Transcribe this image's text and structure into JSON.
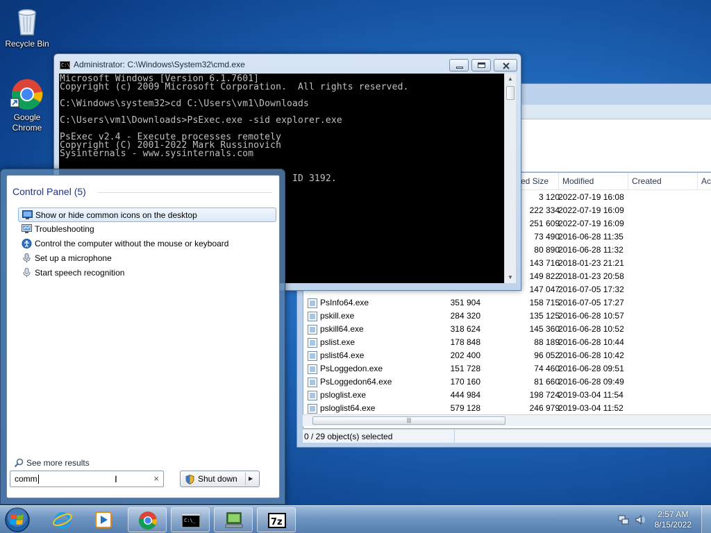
{
  "desktop": {
    "icons": [
      {
        "label": "Recycle Bin"
      },
      {
        "label": "Google Chrome"
      }
    ]
  },
  "cmd": {
    "title": "Administrator: C:\\Windows\\System32\\cmd.exe",
    "console_text": "Microsoft Windows [Version 6.1.7601]\nCopyright (c) 2009 Microsoft Corporation.  All rights reserved.\n\nC:\\Windows\\system32>cd C:\\Users\\vm1\\Downloads\n\nC:\\Users\\vm1\\Downloads>PsExec.exe -sid explorer.exe\n\nPsExec v2.4 - Execute processes remotely\nCopyright (C) 2001-2022 Mark Russinovich\nSysinternals - www.sysinternals.com\n\n\n                                          ID 3192."
  },
  "explorer": {
    "columns": [
      "ed Size",
      "Modified",
      "Created",
      "Acc"
    ],
    "rows": [
      {
        "name": "",
        "size": "",
        "csize": "3 120",
        "modified": "2022-07-19 16:08"
      },
      {
        "name": "",
        "size": "",
        "csize": "222 334",
        "modified": "2022-07-19 16:09"
      },
      {
        "name": "",
        "size": "",
        "csize": "251 609",
        "modified": "2022-07-19 16:09"
      },
      {
        "name": "",
        "size": "",
        "csize": "73 490",
        "modified": "2016-06-28 11:35"
      },
      {
        "name": "",
        "size": "",
        "csize": "80 890",
        "modified": "2016-06-28 11:32"
      },
      {
        "name": "",
        "size": "",
        "csize": "143 716",
        "modified": "2018-01-23 21:21"
      },
      {
        "name": "",
        "size": "",
        "csize": "149 822",
        "modified": "2018-01-23 20:58"
      },
      {
        "name": "",
        "size": "",
        "csize": "147 047",
        "modified": "2016-07-05 17:32"
      },
      {
        "name": "PsInfo64.exe",
        "size": "351 904",
        "csize": "158 715",
        "modified": "2016-07-05 17:27"
      },
      {
        "name": "pskill.exe",
        "size": "284 320",
        "csize": "135 125",
        "modified": "2016-06-28 10:57"
      },
      {
        "name": "pskill64.exe",
        "size": "318 624",
        "csize": "145 360",
        "modified": "2016-06-28 10:52"
      },
      {
        "name": "pslist.exe",
        "size": "178 848",
        "csize": "88 189",
        "modified": "2016-06-28 10:44"
      },
      {
        "name": "pslist64.exe",
        "size": "202 400",
        "csize": "96 052",
        "modified": "2016-06-28 10:42"
      },
      {
        "name": "PsLoggedon.exe",
        "size": "151 728",
        "csize": "74 460",
        "modified": "2016-06-28 09:51"
      },
      {
        "name": "PsLoggedon64.exe",
        "size": "170 160",
        "csize": "81 660",
        "modified": "2016-06-28 09:49"
      },
      {
        "name": "psloglist.exe",
        "size": "444 984",
        "csize": "198 724",
        "modified": "2019-03-04 11:54"
      },
      {
        "name": "psloglist64.exe",
        "size": "579 128",
        "csize": "246 979",
        "modified": "2019-03-04 11:52"
      }
    ],
    "status": "0 / 29 object(s) selected"
  },
  "startmenu": {
    "section_title": "Control Panel (5)",
    "results": [
      {
        "label": "Show or hide common icons on the desktop",
        "icon": "desktop-monitor-icon"
      },
      {
        "label": "Troubleshooting",
        "icon": "troubleshooting-icon"
      },
      {
        "label": "Control the computer without the mouse or keyboard",
        "icon": "ease-of-access-icon"
      },
      {
        "label": "Set up a microphone",
        "icon": "microphone-icon"
      },
      {
        "label": "Start speech recognition",
        "icon": "speech-icon"
      }
    ],
    "see_more": "See more results",
    "search_value": "comm",
    "shutdown_label": "Shut down"
  },
  "taskbar": {
    "items": [
      "start-orb",
      "internet-explorer",
      "media-player",
      "google-chrome",
      "command-prompt",
      "remote-desktop",
      "7-zip"
    ],
    "time": "2:57 AM",
    "date": "8/15/2022"
  }
}
